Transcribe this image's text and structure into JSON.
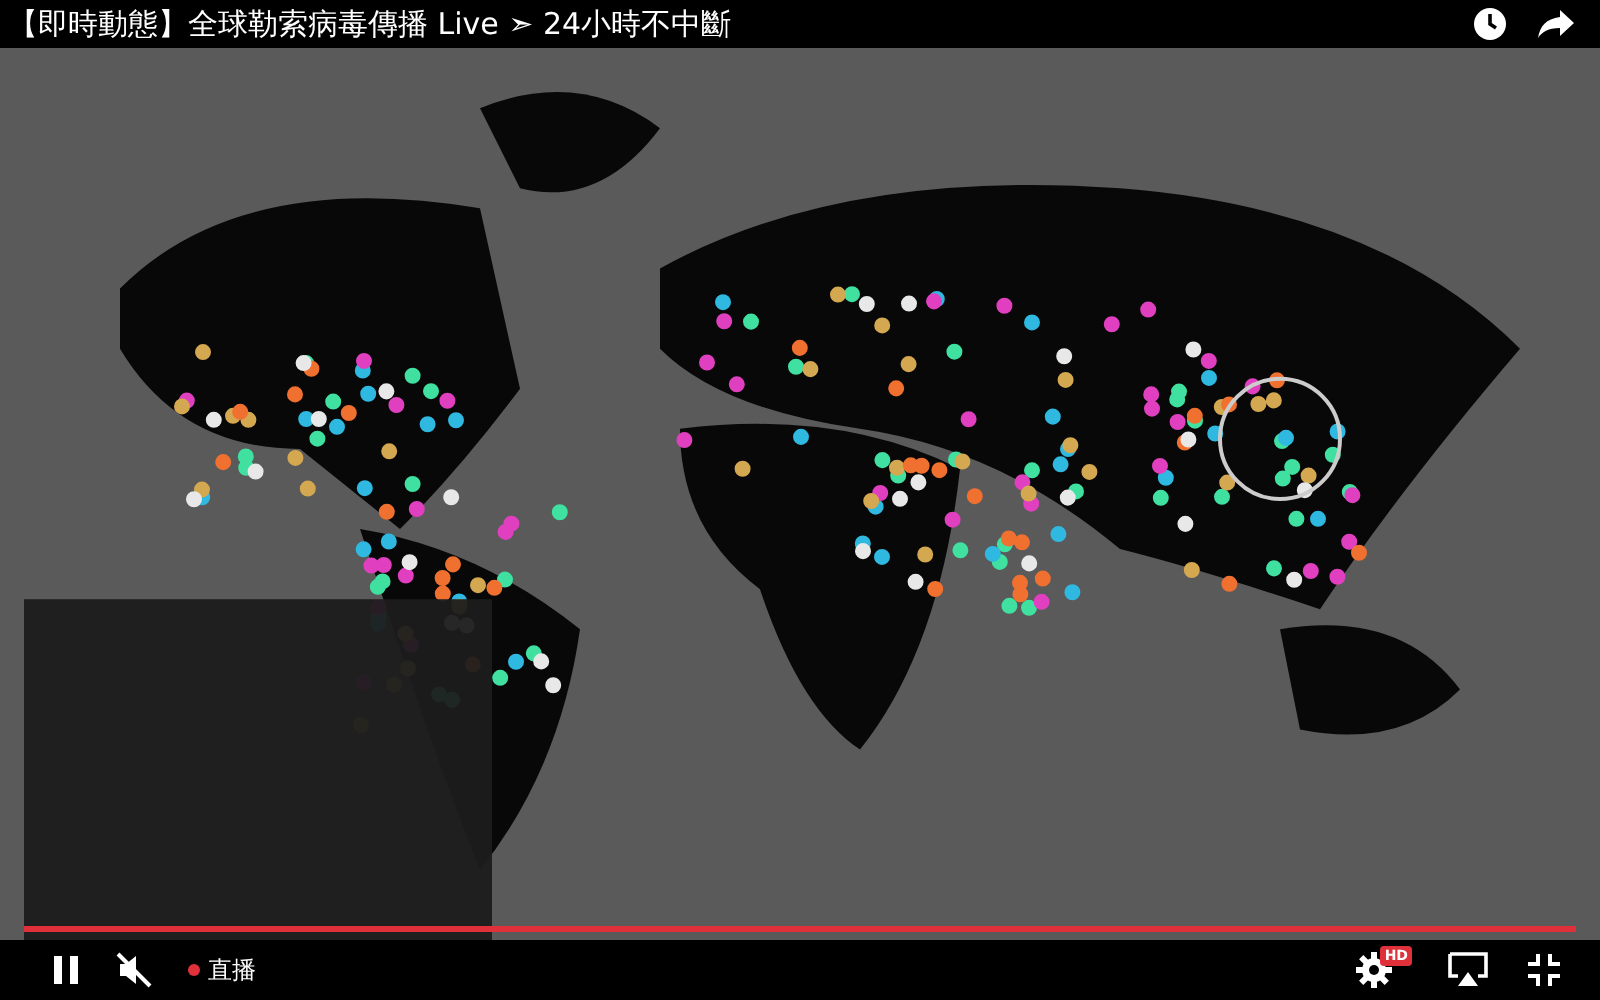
{
  "video": {
    "title": "【即時動態】全球勒索病毒傳播 Live ➣ 24小時不中斷",
    "kind": "picture"
  },
  "progress": {
    "level": 1
  },
  "controls": {
    "playing": true,
    "muted": true,
    "live_label": "直播",
    "quality_badge": "HD"
  }
}
